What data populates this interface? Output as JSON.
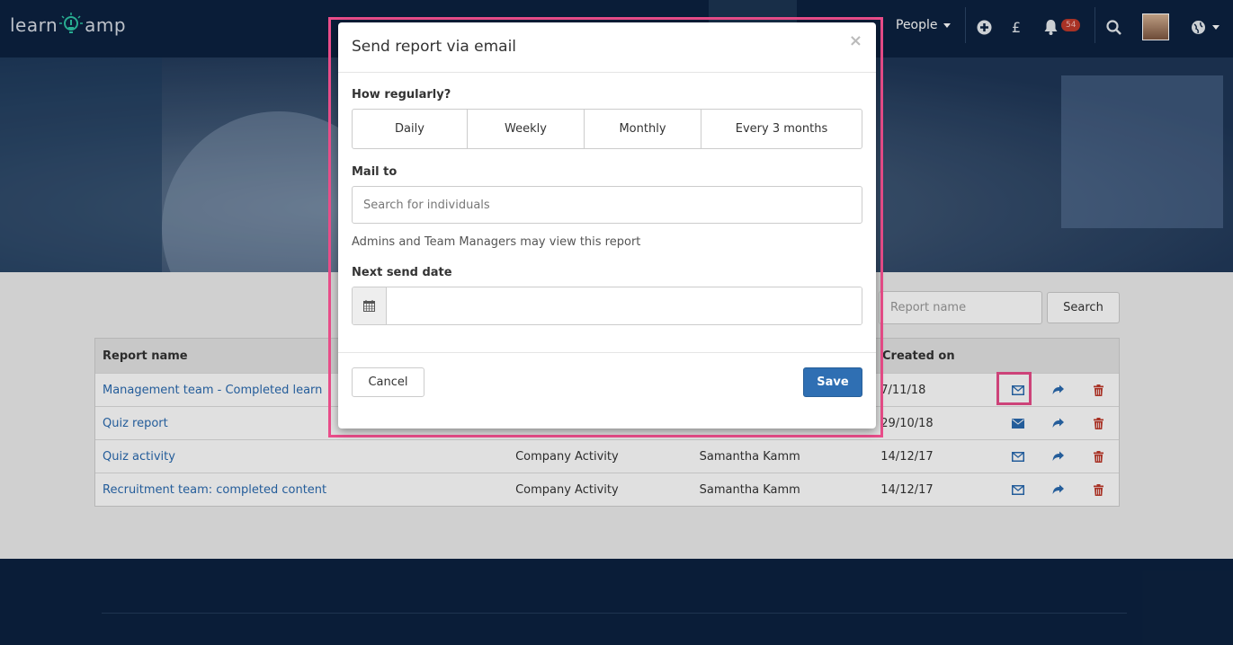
{
  "nav": {
    "logo_left": "learn",
    "logo_right": "amp",
    "people_label": "People",
    "notification_count": "54",
    "currency_symbol": "£"
  },
  "search": {
    "placeholder": "Report name",
    "button_label": "Search"
  },
  "table": {
    "headers": [
      "Report name",
      "",
      "",
      "Created on"
    ],
    "rows": [
      {
        "name": "Management team - Completed learn",
        "type": "",
        "owner": "",
        "created": "7/11/18"
      },
      {
        "name": "Quiz report",
        "type": "",
        "owner": "",
        "created": "29/10/18"
      },
      {
        "name": "Quiz activity",
        "type": "Company Activity",
        "owner": "Samantha Kamm",
        "created": "14/12/17"
      },
      {
        "name": "Recruitment team: completed content",
        "type": "Company Activity",
        "owner": "Samantha Kamm",
        "created": "14/12/17"
      }
    ]
  },
  "modal": {
    "title": "Send report via email",
    "close": "×",
    "regularity_label": "How regularly?",
    "frequency_options": [
      "Daily",
      "Weekly",
      "Monthly",
      "Every 3 months"
    ],
    "mail_to_label": "Mail to",
    "mail_to_placeholder": "Search for individuals",
    "help_text": "Admins and Team Managers may view this report",
    "next_send_label": "Next send date",
    "next_send_value": "",
    "cancel_label": "Cancel",
    "save_label": "Save"
  },
  "colors": {
    "nav_bg": "#0c2240",
    "link": "#2a6ab0",
    "primary": "#2f6fb3",
    "danger": "#c0392b",
    "highlight": "#ea4d8a"
  }
}
